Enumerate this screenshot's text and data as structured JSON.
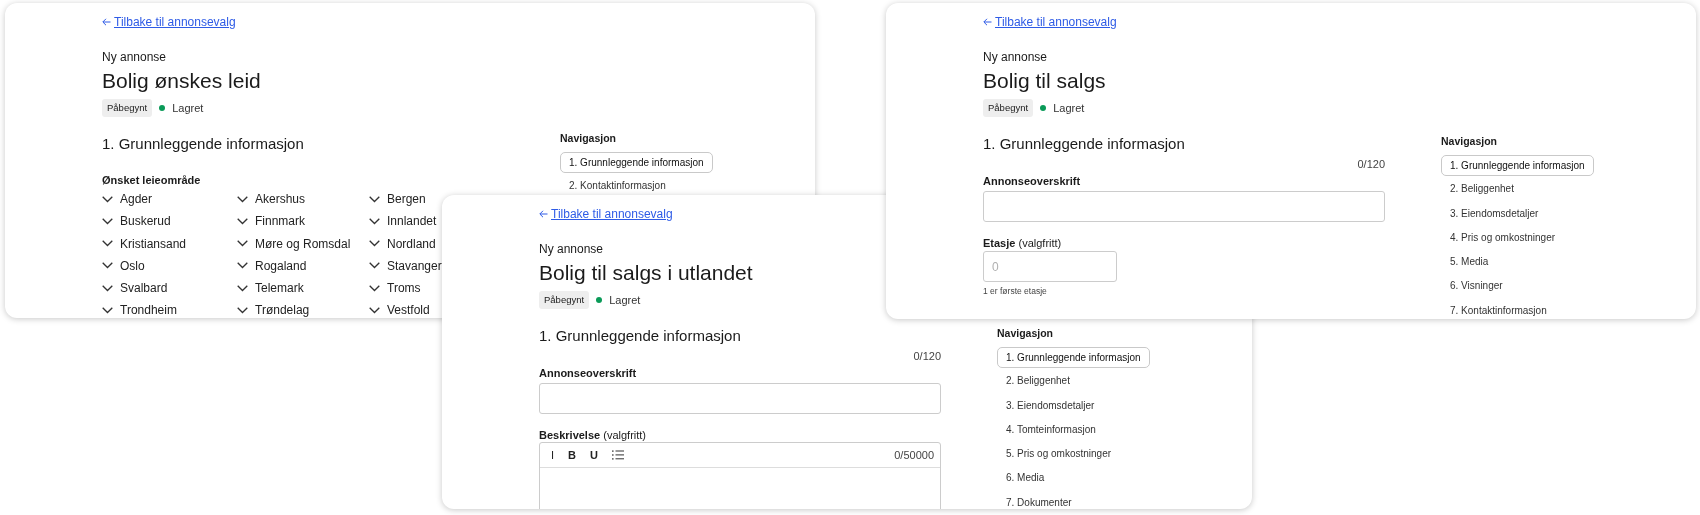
{
  "cards": [
    {
      "kind": "regions",
      "back_link": "Tilbake til annonsevalg",
      "eyebrow": "Ny annonse",
      "title": "Bolig ønskes leid",
      "status_badge": "Påbegynt",
      "saved": "Lagret",
      "section": "1. Grunnleggende informasjon",
      "region_label": "Ønsket leieområde",
      "regions": [
        "Agder",
        "Akershus",
        "Bergen",
        "Buskerud",
        "Finnmark",
        "Innlandet",
        "Kristiansand",
        "Møre og Romsdal",
        "Nordland",
        "Oslo",
        "Rogaland",
        "Stavanger",
        "Svalbard",
        "Telemark",
        "Troms",
        "Trondheim",
        "Trøndelag",
        "Vestfold"
      ],
      "navigation": {
        "heading": "Navigasjon",
        "items": [
          {
            "label": "1. Grunnleggende informasjon",
            "selected": true
          },
          {
            "label": "2. Kontaktinformasjon",
            "selected": false
          }
        ]
      }
    },
    {
      "kind": "form",
      "back_link": "Tilbake til annonsevalg",
      "eyebrow": "Ny annonse",
      "title": "Bolig til salgs i utlandet",
      "status_badge": "Påbegynt",
      "saved": "Lagret",
      "section": "1. Grunnleggende informasjon",
      "fields": [
        {
          "kind": "text",
          "counter": "0/120",
          "label": "Annonseoverskrift"
        },
        {
          "kind": "editor",
          "label": "**Beskrivelse** (valgfritt)",
          "toolbar": [
            "I",
            "B",
            "U"
          ],
          "counter": "0/50000"
        }
      ],
      "navigation": {
        "heading": "Navigasjon",
        "items": [
          {
            "label": "1. Grunnleggende informasjon",
            "selected": true
          },
          {
            "label": "2. Beliggenhet",
            "selected": false
          },
          {
            "label": "3. Eiendomsdetaljer",
            "selected": false
          },
          {
            "label": "4. Tomteinformasjon",
            "selected": false
          },
          {
            "label": "5. Pris og omkostninger",
            "selected": false
          },
          {
            "label": "6. Media",
            "selected": false
          },
          {
            "label": "7. Dokumenter",
            "selected": false
          }
        ]
      }
    },
    {
      "kind": "form",
      "back_link": "Tilbake til annonsevalg",
      "eyebrow": "Ny annonse",
      "title": "Bolig til salgs",
      "status_badge": "Påbegynt",
      "saved": "Lagret",
      "section": "1. Grunnleggende informasjon",
      "fields": [
        {
          "kind": "text",
          "counter": "0/120",
          "label": "Annonseoverskrift"
        },
        {
          "kind": "number",
          "label": "**Etasje** (valgfritt)",
          "placeholder": "0",
          "help": "1 er første etasje"
        }
      ],
      "navigation": {
        "heading": "Navigasjon",
        "items": [
          {
            "label": "1. Grunnleggende informasjon",
            "selected": true
          },
          {
            "label": "2. Beliggenhet",
            "selected": false
          },
          {
            "label": "3. Eiendomsdetaljer",
            "selected": false
          },
          {
            "label": "4. Pris og omkostninger",
            "selected": false
          },
          {
            "label": "5. Media",
            "selected": false
          },
          {
            "label": "6. Visninger",
            "selected": false
          },
          {
            "label": "7. Kontaktinformasjon",
            "selected": false
          }
        ]
      }
    }
  ]
}
